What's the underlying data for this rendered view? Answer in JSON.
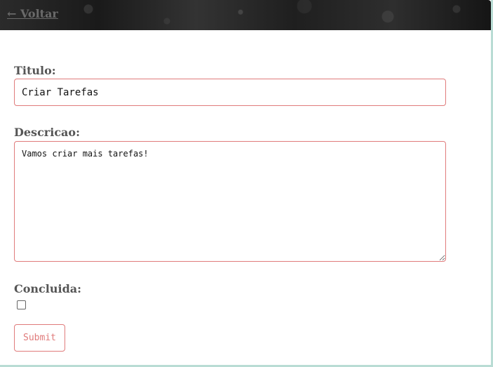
{
  "header": {
    "back_label": "← Voltar"
  },
  "form": {
    "titulo_label": "Titulo:",
    "titulo_value": "Criar Tarefas",
    "descricao_label": "Descricao:",
    "descricao_value": "Vamos criar mais tarefas!",
    "concluida_label": "Concluida:",
    "concluida_checked": false,
    "submit_label": "Submit"
  },
  "colors": {
    "accent": "#e07b7b",
    "label_text": "#555555",
    "frame": "#b9dcd4"
  }
}
